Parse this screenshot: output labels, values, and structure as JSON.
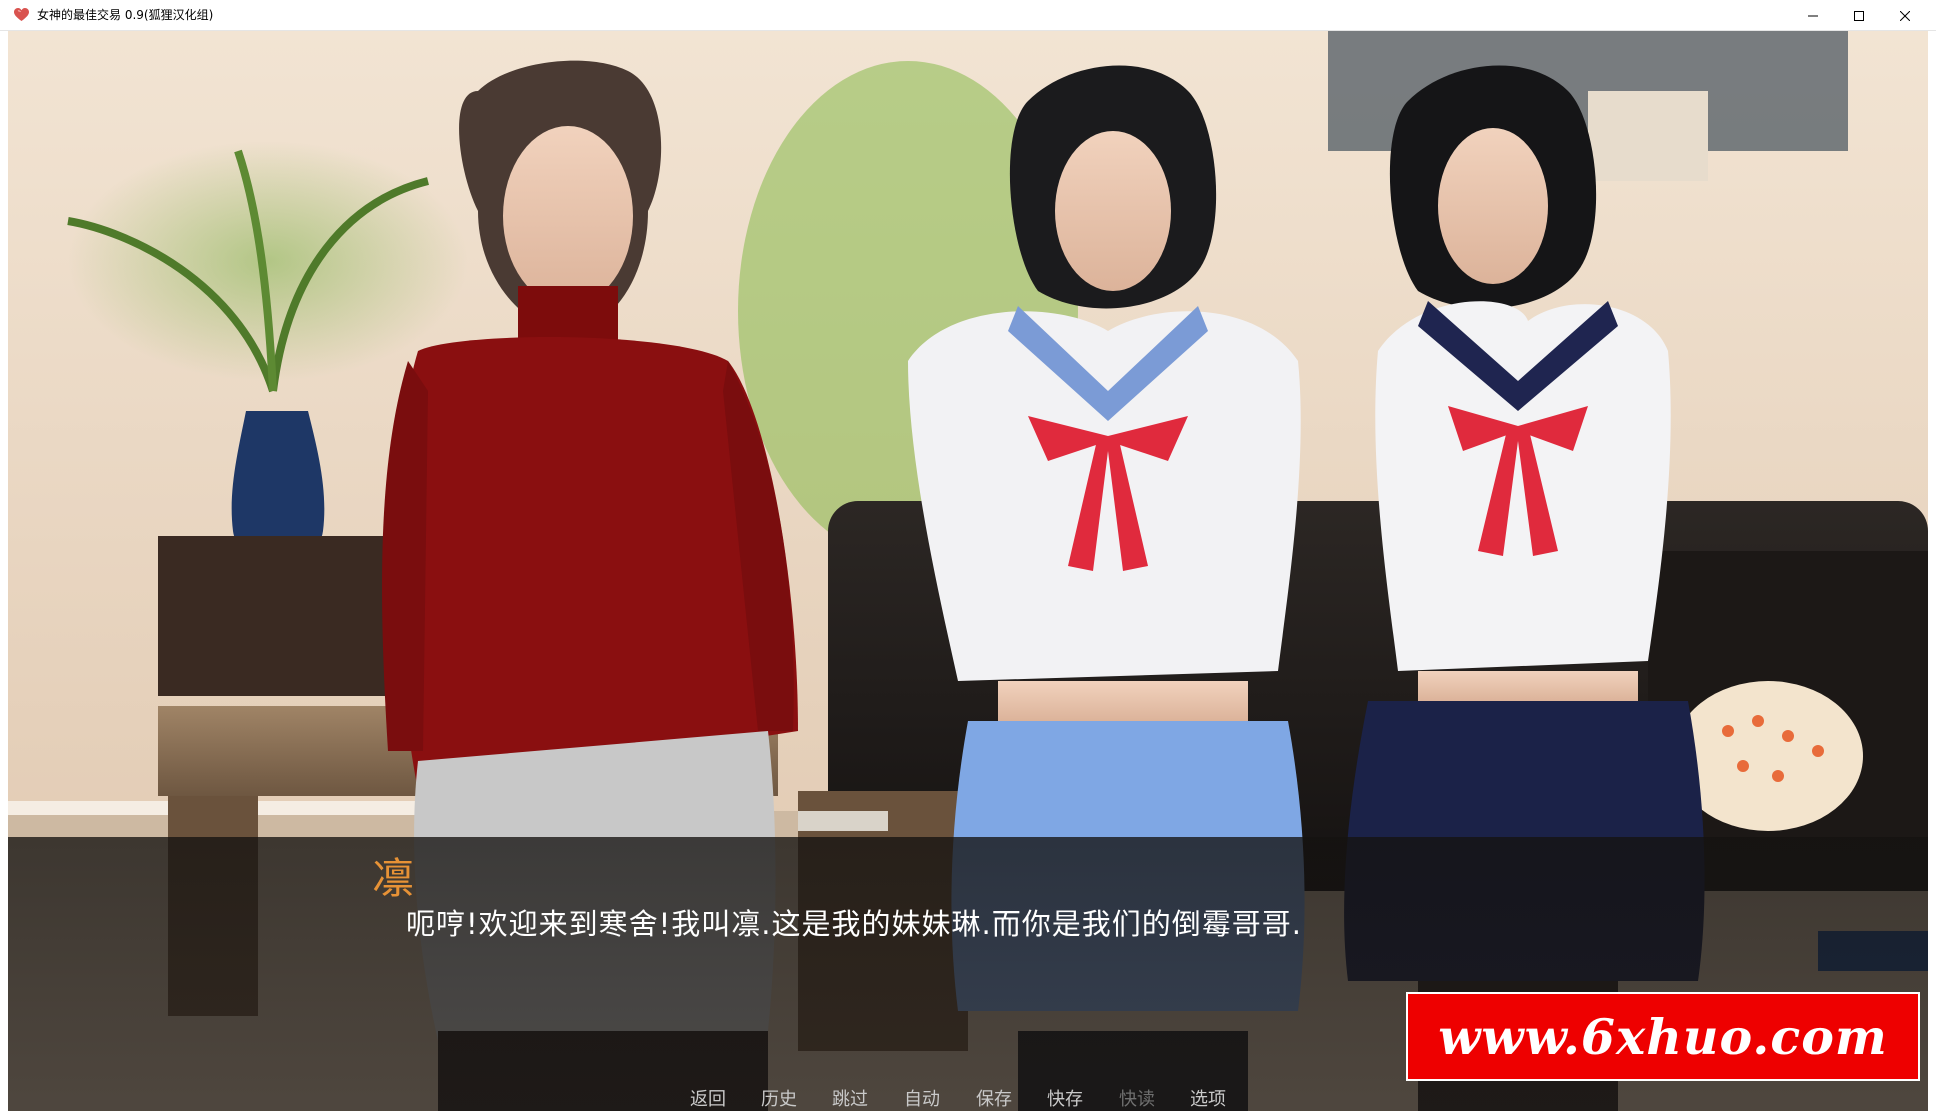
{
  "window": {
    "title": "女神的最佳交易 0.9(狐狸汉化组)",
    "icon": "heart-app-icon",
    "controls": [
      "minimize-icon",
      "maximize-icon",
      "close-icon"
    ]
  },
  "dialogue": {
    "speaker": "凛",
    "text": "呃哼!欢迎来到寒舍!我叫凛.这是我的妹妹琳.而你是我们的倒霉哥哥.",
    "speaker_color": "#e79236"
  },
  "quick_menu": {
    "back": "返回",
    "history": "历史",
    "skip": "跳过",
    "auto": "自动",
    "save": "保存",
    "quick_save": "快存",
    "quick_load": "快读",
    "preferences": "选项",
    "quick_load_state": "disabled"
  },
  "watermark": {
    "text": "www.6xhuo.com",
    "background": "#ee0000"
  }
}
